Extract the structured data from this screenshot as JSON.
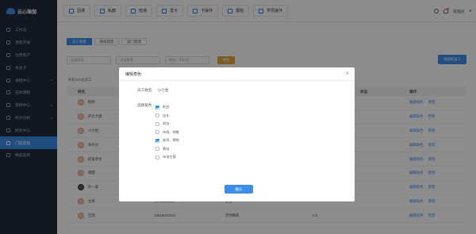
{
  "app": {
    "title": "云心瑜伽"
  },
  "topbar": {
    "tabs": [
      "团课",
      "私教",
      "班课",
      "发卡",
      "卡操作",
      "报班",
      "学员操作"
    ],
    "user": "管理员"
  },
  "sidebar": {
    "items": [
      {
        "label": "工作台",
        "has_chevron": false
      },
      {
        "label": "潜客开发",
        "has_chevron": false
      },
      {
        "label": "付费客户",
        "has_chevron": false
      },
      {
        "label": "会员卡",
        "has_chevron": false
      },
      {
        "label": "课程中心",
        "has_chevron": true
      },
      {
        "label": "在线课程",
        "has_chevron": false
      },
      {
        "label": "营销中心",
        "has_chevron": true
      },
      {
        "label": "统计分析",
        "has_chevron": true
      },
      {
        "label": "财务中心",
        "has_chevron": false
      },
      {
        "label": "门店管理",
        "has_chevron": false,
        "active": true
      },
      {
        "label": "精品案例",
        "has_chevron": false
      }
    ]
  },
  "main": {
    "subtabs": [
      "员工管理",
      "教练管理",
      "部门管理"
    ],
    "filters": {
      "status": "全部状态",
      "role": "全部角色",
      "search_placeholder": "姓名、手机号",
      "search_button": "搜索"
    },
    "add_button": "添加新员工",
    "total": "共有101位员工",
    "table": {
      "headers": {
        "name": "姓名",
        "status": "状态",
        "ops": "操作"
      },
      "rows": [
        {
          "name": "欧欧",
          "phone": "",
          "role": "",
          "x": ""
        },
        {
          "name": "萨达卡瑟",
          "phone": "",
          "role": "",
          "x": ""
        },
        {
          "name": "小小星",
          "phone": "",
          "role": "",
          "x": ""
        },
        {
          "name": "朱尔力",
          "phone": "",
          "role": "",
          "x": ""
        },
        {
          "name": "提督老师",
          "phone": "",
          "role": "",
          "x": ""
        },
        {
          "name": "嘤嘤",
          "phone": "",
          "role": "",
          "x": ""
        },
        {
          "name": "叶一安",
          "phone": "",
          "role": "",
          "x": ""
        },
        {
          "name": "左青",
          "phone": "15701263402",
          "role": "前台",
          "x": "--"
        },
        {
          "name": "佳琪",
          "phone": "13818243343",
          "role": "老师教练",
          "x": "4.0"
        }
      ],
      "op_edit": "编辑角色",
      "op_manage": "管理"
    }
  },
  "modal": {
    "title": "编辑角色",
    "employee_label": "员工姓名",
    "employee_name": "小小星",
    "roles_label": "选择角色",
    "roles": [
      {
        "label": "前台",
        "checked": true
      },
      {
        "label": "店长",
        "checked": false
      },
      {
        "label": "财务",
        "checked": false
      },
      {
        "label": "市场、销售",
        "checked": false
      },
      {
        "label": "老师、教练",
        "checked": true
      },
      {
        "label": "教务",
        "checked": false
      },
      {
        "label": "市场主管",
        "checked": false
      }
    ],
    "confirm": "确认"
  }
}
